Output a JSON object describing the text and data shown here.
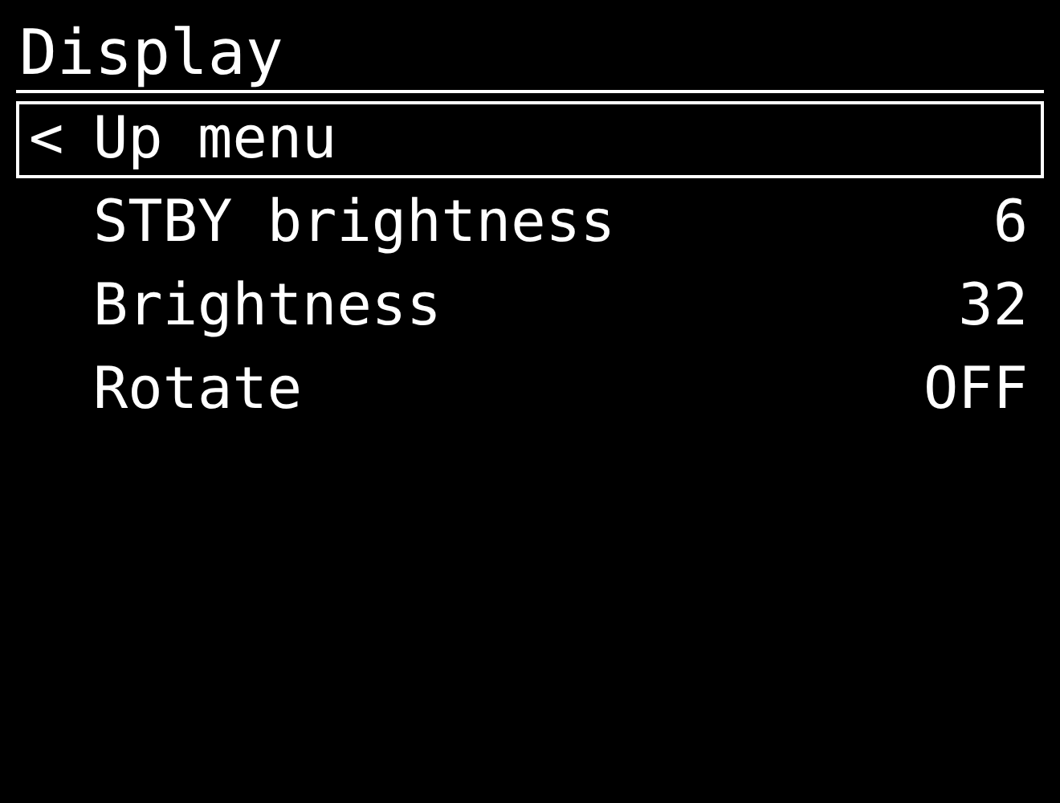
{
  "title": "Display",
  "items": [
    {
      "kind": "back",
      "icon": "<",
      "label": "Up menu",
      "selected": true
    },
    {
      "kind": "setting",
      "label": "STBY brightness",
      "value": "6",
      "selected": false
    },
    {
      "kind": "setting",
      "label": "Brightness",
      "value": "32",
      "selected": false
    },
    {
      "kind": "setting",
      "label": "Rotate",
      "value": "OFF",
      "selected": false
    }
  ]
}
